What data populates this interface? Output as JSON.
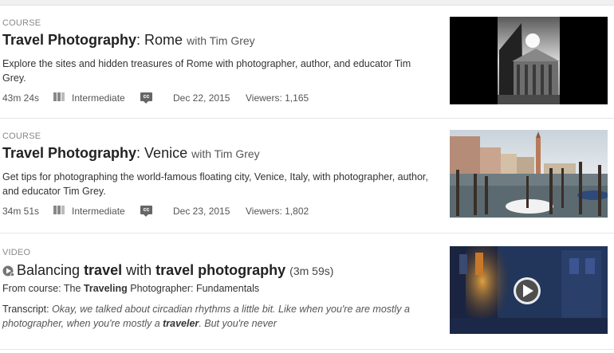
{
  "results": [
    {
      "type": "COURSE",
      "title_strong": "Travel Photography",
      "title_rest": ": Rome",
      "author": "with Tim Grey",
      "description": "Explore the sites and hidden treasures of Rome with photographer, author, and educator Tim Grey.",
      "duration": "43m 24s",
      "level": "Intermediate",
      "cc_label": "cc",
      "date": "Dec 22, 2015",
      "viewers": "Viewers: 1,165",
      "thumbnail_icon": "rome-pantheon-thumbnail"
    },
    {
      "type": "COURSE",
      "title_strong": "Travel Photography",
      "title_rest": ": Venice",
      "author": "with Tim Grey",
      "description": "Get tips for photographing the world-famous floating city, Venice, Italy, with photographer, author, and educator Tim Grey.",
      "duration": "34m 51s",
      "level": "Intermediate",
      "cc_label": "cc",
      "date": "Dec 23, 2015",
      "viewers": "Viewers: 1,802",
      "thumbnail_icon": "venice-canal-thumbnail"
    },
    {
      "type": "VIDEO",
      "title_part1": "Balancing ",
      "title_bold1": "travel",
      "title_part2": " with ",
      "title_bold2": "travel photography",
      "duration": "(3m 59s)",
      "from_prefix": "From course: The ",
      "from_bold": "Traveling",
      "from_rest": " Photographer: Fundamentals",
      "transcript_label": "Transcript: ",
      "transcript_1": "Okay, we talked about circadian rhythms a little bit. Like when you're are mostly a photographer, when you're mostly a ",
      "transcript_bold": "traveler",
      "transcript_2": ". But you're never",
      "thumbnail_icon": "night-street-video-thumbnail"
    }
  ],
  "colors": {
    "title": "#222222",
    "meta": "#555555",
    "divider": "#e6e6e6"
  }
}
